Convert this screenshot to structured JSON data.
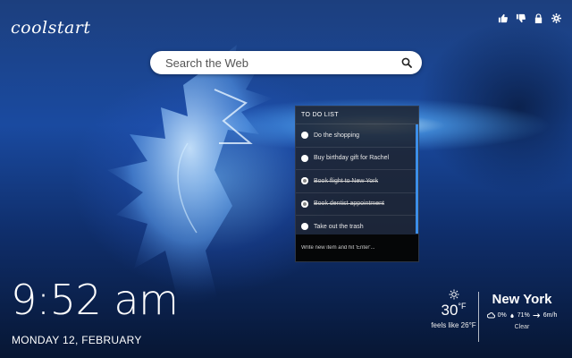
{
  "brand": {
    "logo": "coolstart"
  },
  "top_icons": [
    "thumbs-up-icon",
    "thumbs-down-icon",
    "lock-icon",
    "gear-icon"
  ],
  "search": {
    "placeholder": "Search the Web"
  },
  "todo": {
    "title": "TO DO LIST",
    "items": [
      {
        "label": "Do the shopping",
        "done": false
      },
      {
        "label": "Buy birthday gift for Rachel",
        "done": false
      },
      {
        "label": "Book flight to New York",
        "done": true
      },
      {
        "label": "Book dentist appointment",
        "done": true
      },
      {
        "label": "Take out the trash",
        "done": false
      }
    ],
    "input_placeholder": "Write new item and hit 'Enter'..."
  },
  "clock": {
    "time": "9:52 am",
    "date": "MONDAY 12, FEBRUARY"
  },
  "weather": {
    "temp": "30",
    "unit": "°F",
    "feels_like": "feels like 26°F",
    "city": "New York",
    "precip": "0%",
    "humidity": "71%",
    "wind": "6m/h",
    "condition": "Clear"
  },
  "colors": {
    "accent": "#3c8ee8",
    "panel": "#1e2430"
  }
}
